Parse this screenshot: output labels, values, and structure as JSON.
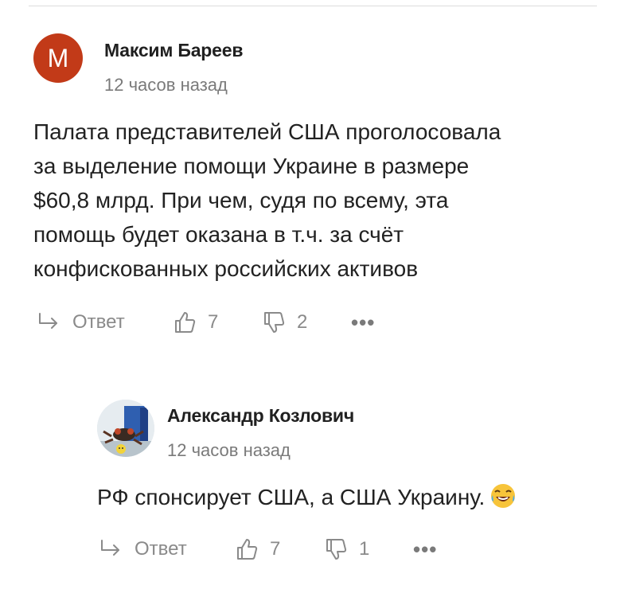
{
  "comments": [
    {
      "author": "Максим Бареев",
      "avatar_letter": "М",
      "time": "12 часов назад",
      "text_lines": [
        "Палата представителей США проголосовала",
        "за выделение помощи Украине в размере",
        "$60,8 млрд. При чем, судя по всему, эта",
        "помощь будет оказана в т.ч. за счёт",
        "конфискованных российских активов"
      ],
      "reply_label": "Ответ",
      "likes": "7",
      "dislikes": "2",
      "more_label": "•••"
    },
    {
      "author": "Александр Козлович",
      "time": "12 часов назад",
      "text": "РФ спонсирует США, а США Украину.",
      "reply_label": "Ответ",
      "likes": "7",
      "dislikes": "1",
      "more_label": "•••"
    }
  ],
  "colors": {
    "avatar_bg": "#c23a18",
    "muted": "#8a8a8a"
  }
}
